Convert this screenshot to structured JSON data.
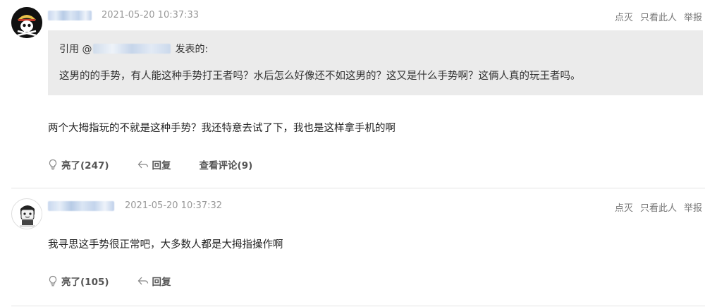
{
  "posts": [
    {
      "time": "2021-05-20 10:37:33",
      "actions": [
        "点灭",
        "只看此人",
        "举报"
      ],
      "quote": {
        "prefix": "引用 @",
        "suffix": "发表的:",
        "text": "这男的的手势，有人能这种手势打王者吗？水后怎么好像还不如这男的？这又是什么手势啊？这俩人真的玩王者吗。"
      },
      "content": "两个大拇指玩的不就是这种手势？我还特意去试了下，我也是这样拿手机的啊",
      "footer": {
        "like_label": "亮了(247)",
        "reply_label": "回复",
        "view_comments_label": "查看评论(9)"
      }
    },
    {
      "time": "2021-05-20 10:37:32",
      "actions": [
        "点灭",
        "只看此人",
        "举报"
      ],
      "content": "我寻思这手势很正常吧，大多数人都是大拇指操作啊",
      "footer": {
        "like_label": "亮了(105)",
        "reply_label": "回复"
      }
    }
  ],
  "colors": {
    "meta_text": "#999999",
    "quote_bg": "#ebebeb",
    "divider": "#e4e4e4"
  },
  "icons": [
    "pirate-skull-avatar",
    "cartoon-avatar",
    "light-bulb-icon",
    "reply-arrow-icon"
  ]
}
